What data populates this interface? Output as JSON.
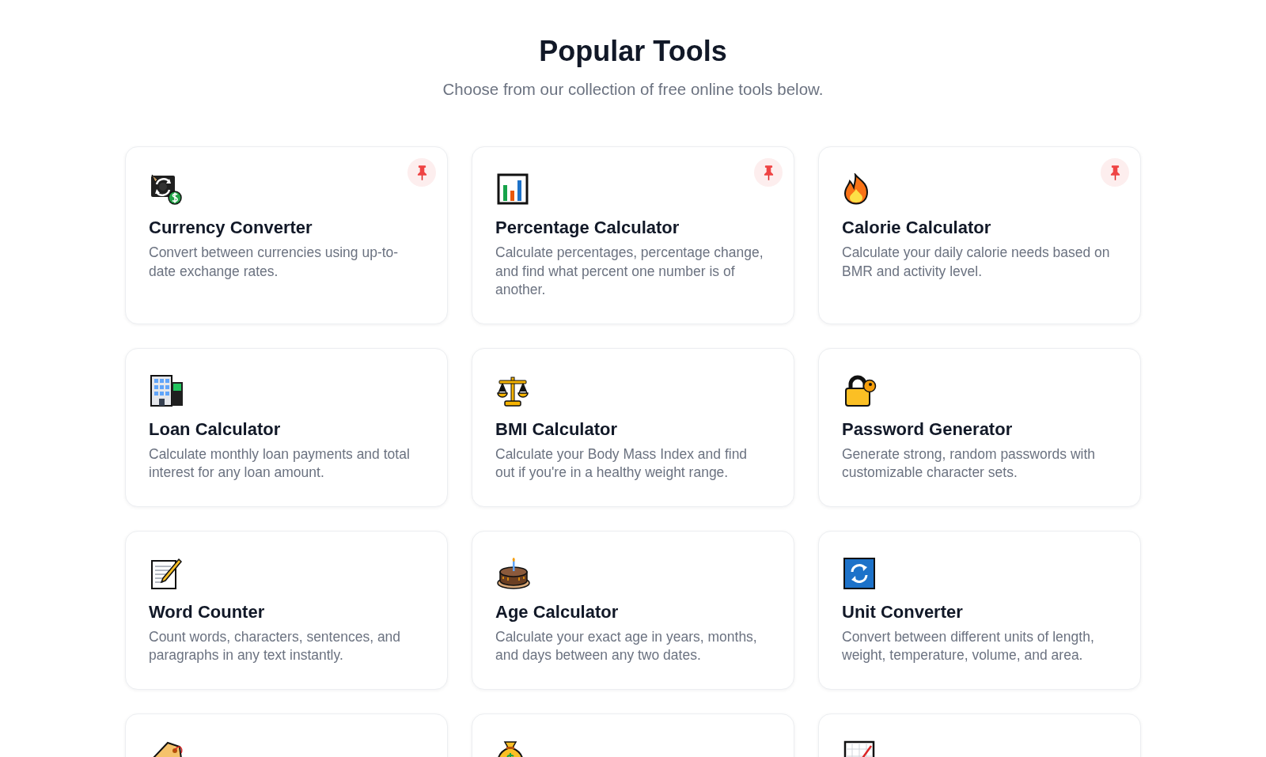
{
  "header": {
    "title": "Popular Tools",
    "subtitle": "Choose from our collection of free online tools below."
  },
  "tools": [
    {
      "title": "Currency Converter",
      "description": "Convert between currencies using up-to-date exchange rates.",
      "pinned": true
    },
    {
      "title": "Percentage Calculator",
      "description": "Calculate percentages, percentage change, and find what percent one number is of another.",
      "pinned": true
    },
    {
      "title": "Calorie Calculator",
      "description": "Calculate your daily calorie needs based on BMR and activity level.",
      "pinned": true
    },
    {
      "title": "Loan Calculator",
      "description": "Calculate monthly loan payments and total interest for any loan amount.",
      "pinned": false
    },
    {
      "title": "BMI Calculator",
      "description": "Calculate your Body Mass Index and find out if you're in a healthy weight range.",
      "pinned": false
    },
    {
      "title": "Password Generator",
      "description": "Generate strong, random passwords with customizable character sets.",
      "pinned": false
    },
    {
      "title": "Word Counter",
      "description": "Count words, characters, sentences, and paragraphs in any text instantly.",
      "pinned": false
    },
    {
      "title": "Age Calculator",
      "description": "Calculate your exact age in years, months, and days between any two dates.",
      "pinned": false
    },
    {
      "title": "Unit Converter",
      "description": "Convert between different units of length, weight, temperature, volume, and area.",
      "pinned": false
    },
    {
      "pinned": false
    },
    {
      "pinned": false
    },
    {
      "pinned": false
    }
  ]
}
